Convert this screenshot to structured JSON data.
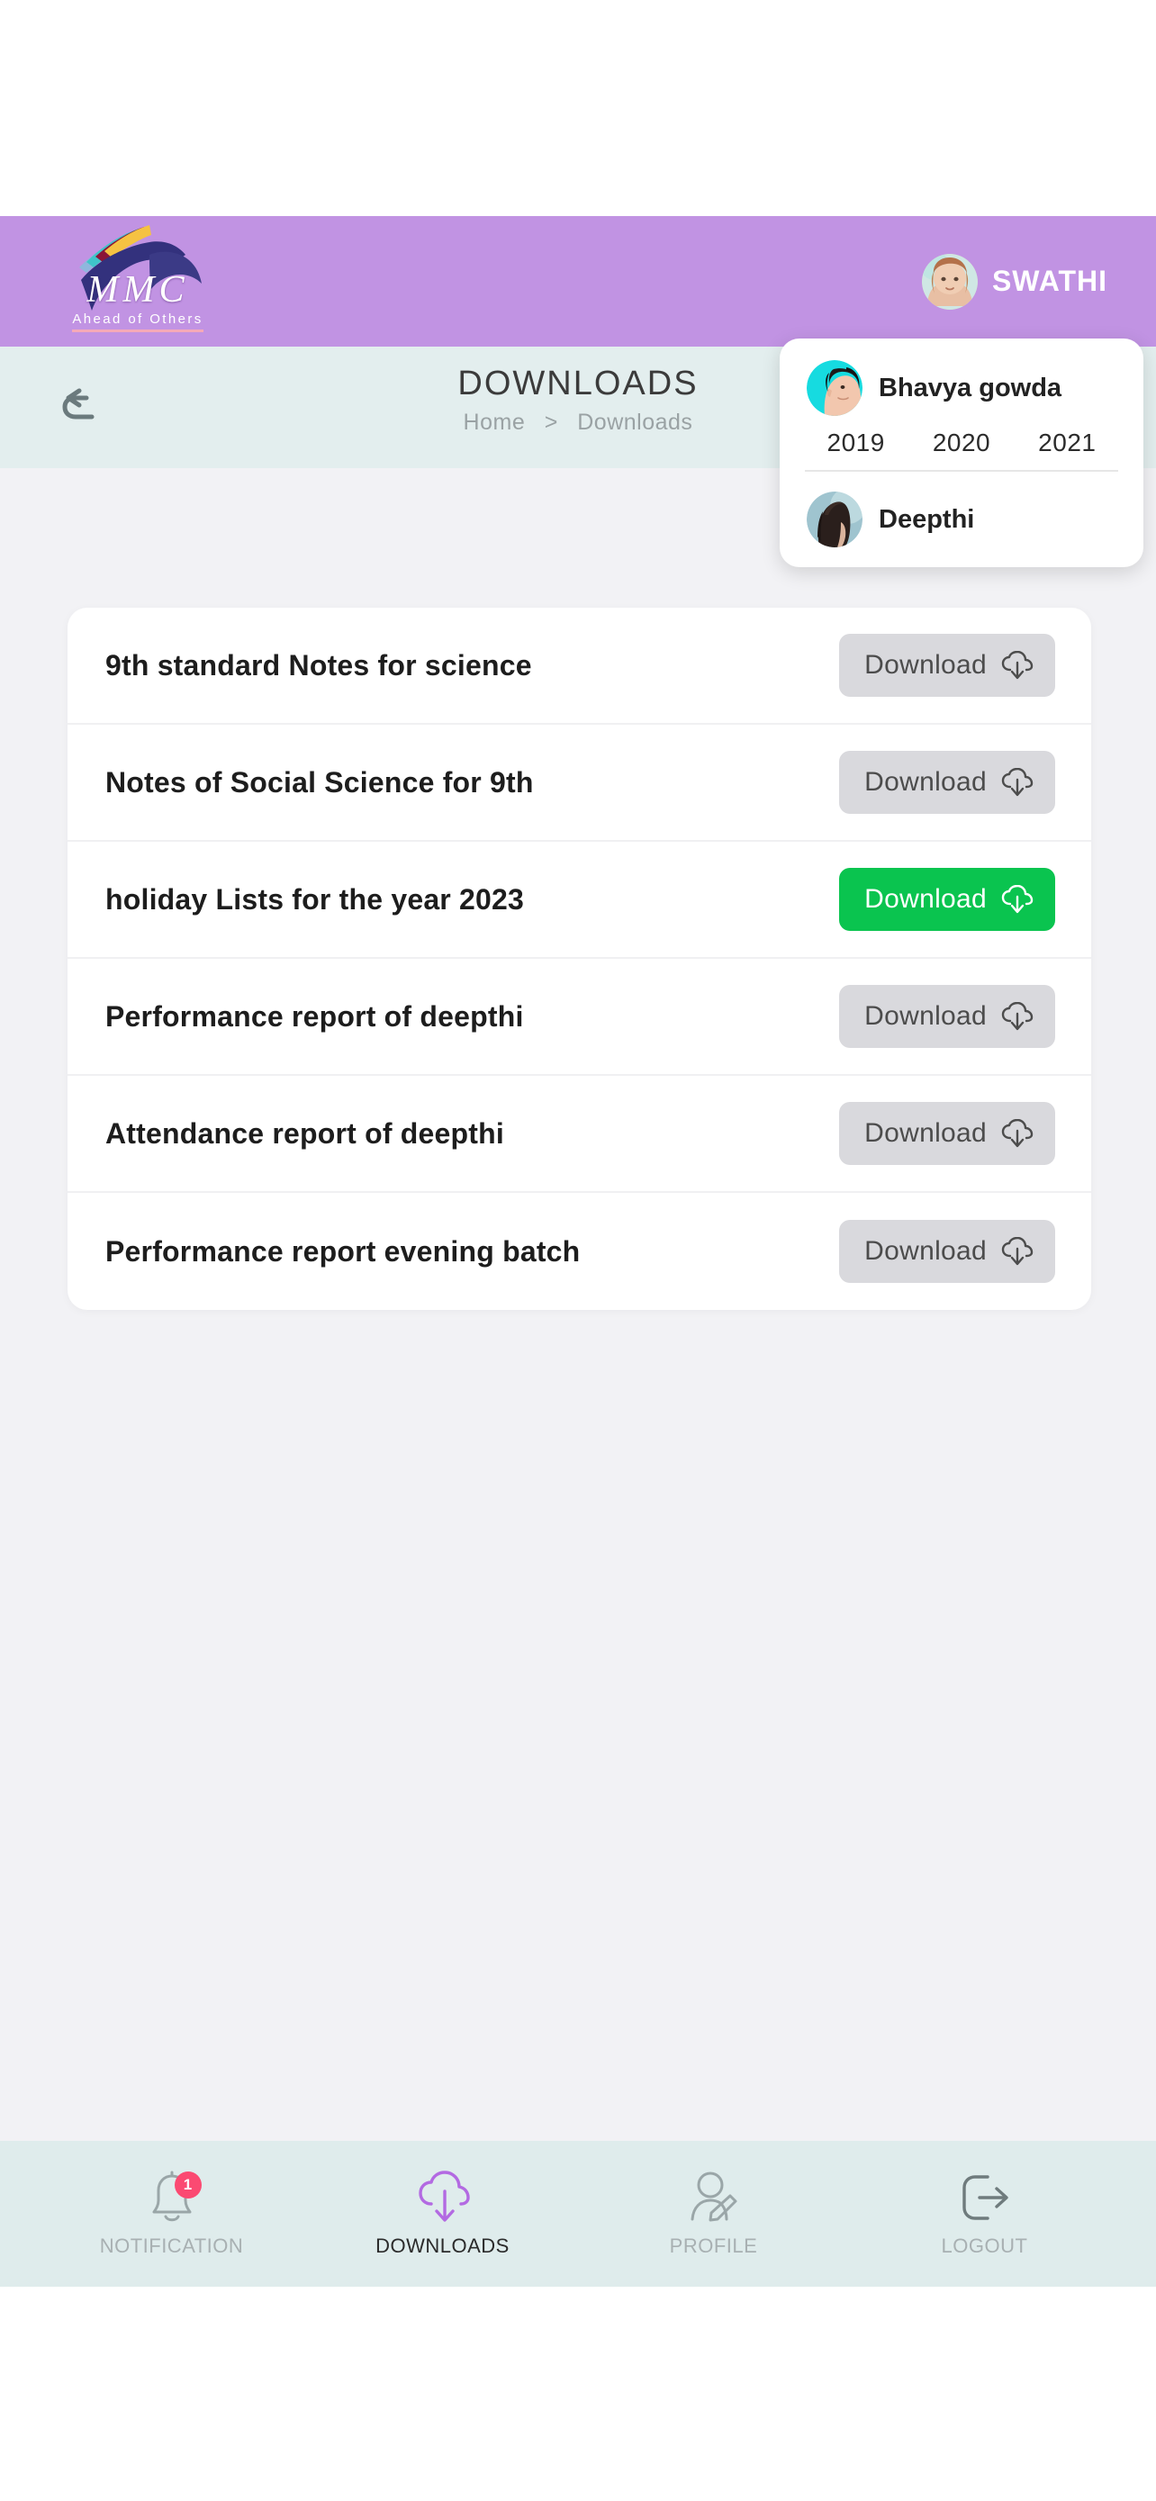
{
  "brand": {
    "logo_title": "MMC",
    "logo_tagline": "Ahead of Others",
    "header_bg": "#c193e3"
  },
  "header": {
    "user_name": "SWATHI",
    "avatar_name": "swathi-avatar"
  },
  "title_band": {
    "page_title": "DOWNLOADS",
    "breadcrumb_home": "Home",
    "breadcrumb_sep": ">",
    "breadcrumb_current": "Downloads",
    "back_icon": "back-undo-arrow-icon"
  },
  "student_popup": {
    "students": [
      {
        "name": "Bhavya gowda",
        "avatar": "bhavya-gowda-avatar"
      },
      {
        "name": "Deepthi",
        "avatar": "deepthi-avatar"
      }
    ],
    "years": [
      "2019",
      "2020",
      "2021"
    ]
  },
  "downloads": {
    "button_label": "Download",
    "button_icon": "cloud-download-icon",
    "active_color": "#0ac44f",
    "inactive_color": "#d9d9dd",
    "items": [
      {
        "title": "9th standard Notes for science",
        "state": "inactive"
      },
      {
        "title": "Notes of Social Science for 9th",
        "state": "inactive"
      },
      {
        "title": "holiday Lists for the year 2023",
        "state": "active"
      },
      {
        "title": "Performance report of deepthi",
        "state": "inactive"
      },
      {
        "title": "Attendance report of deepthi",
        "state": "inactive"
      },
      {
        "title": "Performance report evening batch",
        "state": "inactive"
      }
    ]
  },
  "bottom_nav": {
    "active_color": "#b36ae2",
    "items": [
      {
        "label": "NOTIFICATION",
        "icon": "bell-icon",
        "badge": "1",
        "active": false
      },
      {
        "label": "DOWNLOADS",
        "icon": "cloud-download-icon",
        "badge": "",
        "active": true
      },
      {
        "label": "PROFILE",
        "icon": "person-edit-icon",
        "badge": "",
        "active": false
      },
      {
        "label": "LOGOUT",
        "icon": "logout-arrow-icon",
        "badge": "",
        "active": false
      }
    ]
  }
}
